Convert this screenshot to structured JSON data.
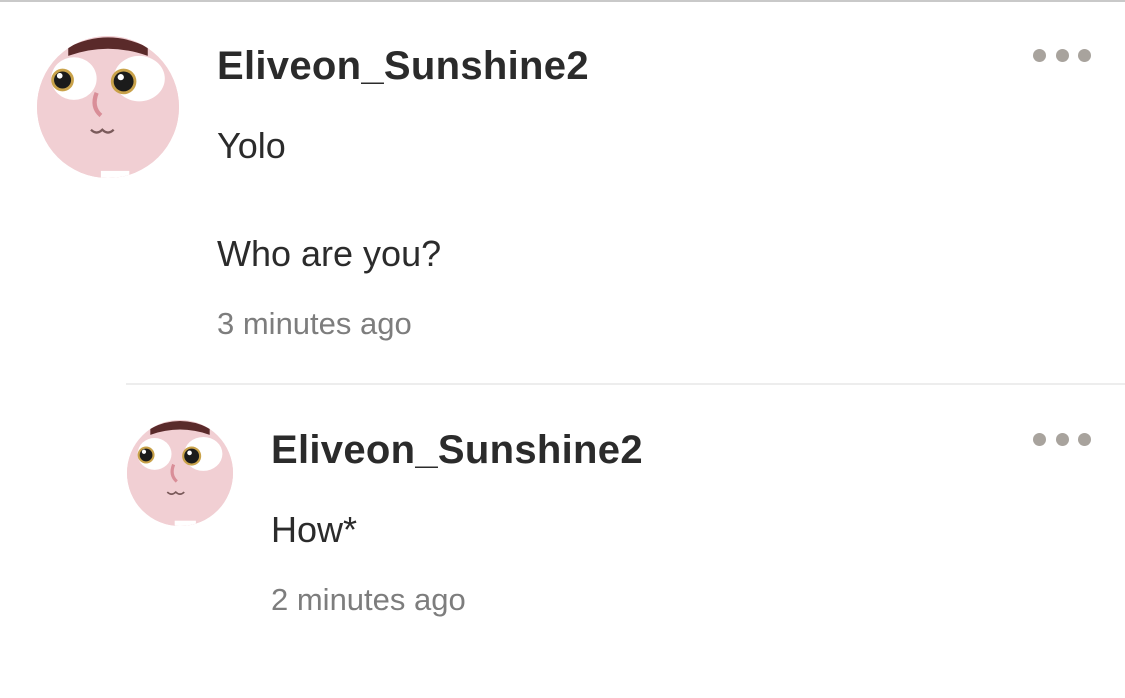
{
  "comments": [
    {
      "username": "Eliveon_Sunshine2",
      "lines": [
        "Yolo",
        "Who are you?"
      ],
      "timestamp": "3 minutes ago",
      "avatar_icon": "cartoon-face-avatar",
      "more_icon": "more-horizontal-icon"
    },
    {
      "username": "Eliveon_Sunshine2",
      "lines": [
        "How*"
      ],
      "timestamp": "2 minutes ago",
      "avatar_icon": "cartoon-face-avatar",
      "more_icon": "more-horizontal-icon"
    }
  ],
  "colors": {
    "username": "#2b2b2b",
    "body_text": "#2b2b2b",
    "timestamp": "#7d7d7d",
    "more_dots": "#a8a39d",
    "avatar_skin": "#f1cfd3",
    "divider": "#ededed"
  }
}
